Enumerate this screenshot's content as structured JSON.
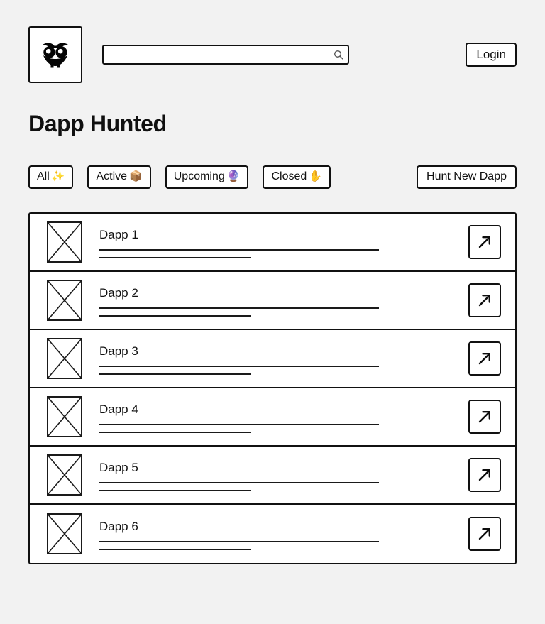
{
  "header": {
    "logo_icon": "owl-icon",
    "search": {
      "value": "",
      "placeholder": "",
      "icon": "search-icon"
    },
    "login_label": "Login"
  },
  "page_title": "Dapp Hunted",
  "filters": [
    {
      "label": "All",
      "emoji": "✨",
      "emoji_name": "sparkles-emoji"
    },
    {
      "label": "Active",
      "emoji": "📦",
      "emoji_name": "package-emoji"
    },
    {
      "label": "Upcoming",
      "emoji": "🔮",
      "emoji_name": "crystal-ball-emoji"
    },
    {
      "label": "Closed",
      "emoji": "✋",
      "emoji_name": "raised-hand-emoji"
    }
  ],
  "primary_action": {
    "label": "Hunt New Dapp"
  },
  "list": {
    "items": [
      {
        "title": "Dapp 1",
        "thumbnail": "image-placeholder",
        "action_icon": "arrow-up-right-icon"
      },
      {
        "title": "Dapp 2",
        "thumbnail": "image-placeholder",
        "action_icon": "arrow-up-right-icon"
      },
      {
        "title": "Dapp 3",
        "thumbnail": "image-placeholder",
        "action_icon": "arrow-up-right-icon"
      },
      {
        "title": "Dapp 4",
        "thumbnail": "image-placeholder",
        "action_icon": "arrow-up-right-icon"
      },
      {
        "title": "Dapp 5",
        "thumbnail": "image-placeholder",
        "action_icon": "arrow-up-right-icon"
      },
      {
        "title": "Dapp 6",
        "thumbnail": "image-placeholder",
        "action_icon": "arrow-up-right-icon"
      }
    ]
  },
  "colors": {
    "background": "#f2f2f2",
    "surface": "#ffffff",
    "border": "#111111",
    "text": "#111111"
  }
}
